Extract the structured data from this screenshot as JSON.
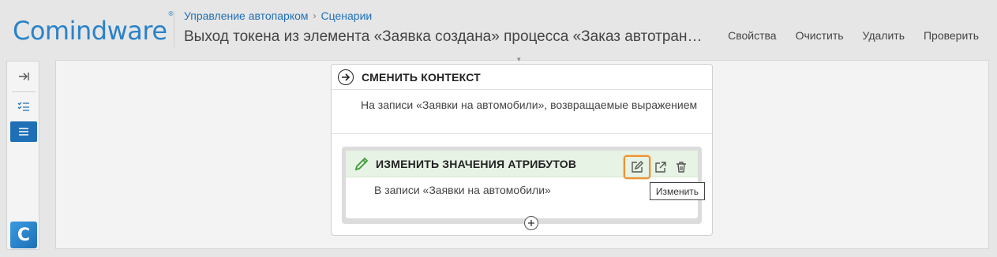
{
  "app": {
    "logo_text": "Comindware",
    "logo_mark": "®",
    "brand_color": "#2a82c8"
  },
  "breadcrumb": {
    "items": [
      "Управление автопарком",
      "Сценарии"
    ],
    "separator": "›"
  },
  "page": {
    "title": "Выход токена из элемента «Заявка создана» процесса «Заказ автотранспорта»"
  },
  "actions": {
    "properties": "Свойства",
    "clear": "Очистить",
    "delete": "Удалить",
    "check": "Проверить"
  },
  "left_toolbar": {
    "logo_letter": "C",
    "active_color": "#1f6fb6"
  },
  "context_card": {
    "title": "СМЕНИТЬ КОНТЕКСТ",
    "description": "На записи «Заявки на автомобили», возвращаемые выражением"
  },
  "inner_card": {
    "title": "ИЗМЕНИТЬ ЗНАЧЕНИЯ АТРИБУТОВ",
    "description": "В записи «Заявки на автомобили»",
    "header_color": "#e7f3e4"
  },
  "tooltip": {
    "text": "Изменить"
  },
  "highlight_color": "#f0922e"
}
